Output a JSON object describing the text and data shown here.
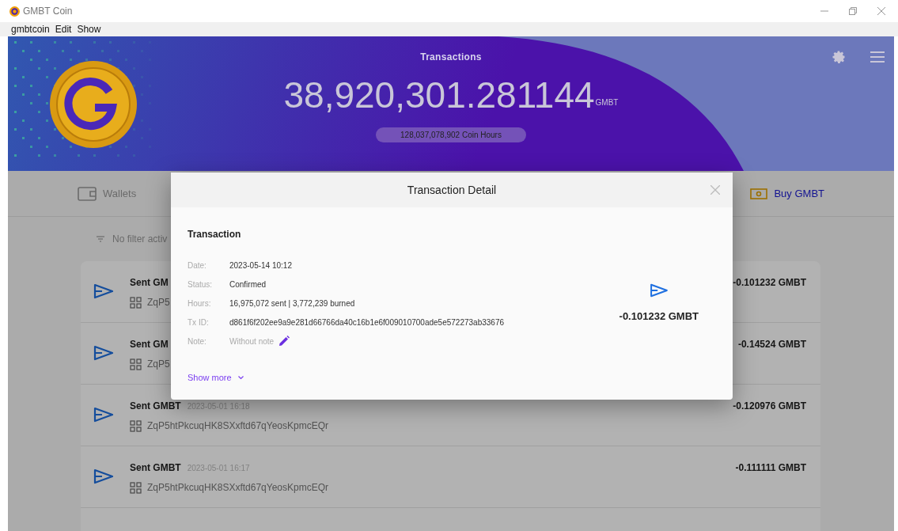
{
  "window": {
    "title": "GMBT Coin"
  },
  "menu": [
    "gmbtcoin",
    "Edit",
    "Show"
  ],
  "header": {
    "title": "Transactions",
    "balance": "38,920,301.281144",
    "unit": "GMBT",
    "hours": "128,037,078,902 Coin Hours"
  },
  "nav": [
    {
      "label": "Wallets",
      "kind": "wallets"
    },
    {
      "label": "Buy GMBT",
      "kind": "buy"
    }
  ],
  "filter": "No filter activ",
  "transactions": [
    {
      "title": "Sent GM",
      "address": "ZqP5",
      "amount": "-0.101232 GMBT"
    },
    {
      "title": "Sent GM",
      "address": "ZqP5",
      "amount": "-0.14524 GMBT"
    },
    {
      "title": "Sent GMBT",
      "date": "2023-05-01 16:18",
      "address": "ZqP5htPkcuqHK8SXxftd67qYeosKpmcEQr",
      "amount": "-0.120976 GMBT"
    },
    {
      "title": "Sent GMBT",
      "date": "2023-05-01 16:17",
      "address": "ZqP5htPkcuqHK8SXxftd67qYeosKpmcEQr",
      "amount": "-0.111111 GMBT"
    }
  ],
  "dialog": {
    "title": "Transaction Detail",
    "section": "Transaction",
    "fields": [
      {
        "label": "Date:",
        "value": "2023-05-14 10:12",
        "kind": "text"
      },
      {
        "label": "Status:",
        "value": "Confirmed",
        "kind": "text"
      },
      {
        "label": "Hours:",
        "value": "16,975,072 sent | 3,772,239 burned",
        "kind": "text"
      },
      {
        "label": "Tx ID:",
        "value": "d861f6f202ee9a9e281d66766da40c16b1e6f009010700ade5e572273ab33676",
        "kind": "text"
      },
      {
        "label": "Note:",
        "value": "Without note",
        "kind": "note"
      }
    ],
    "amount": "-0.101232 GMBT",
    "show_more": "Show more"
  }
}
